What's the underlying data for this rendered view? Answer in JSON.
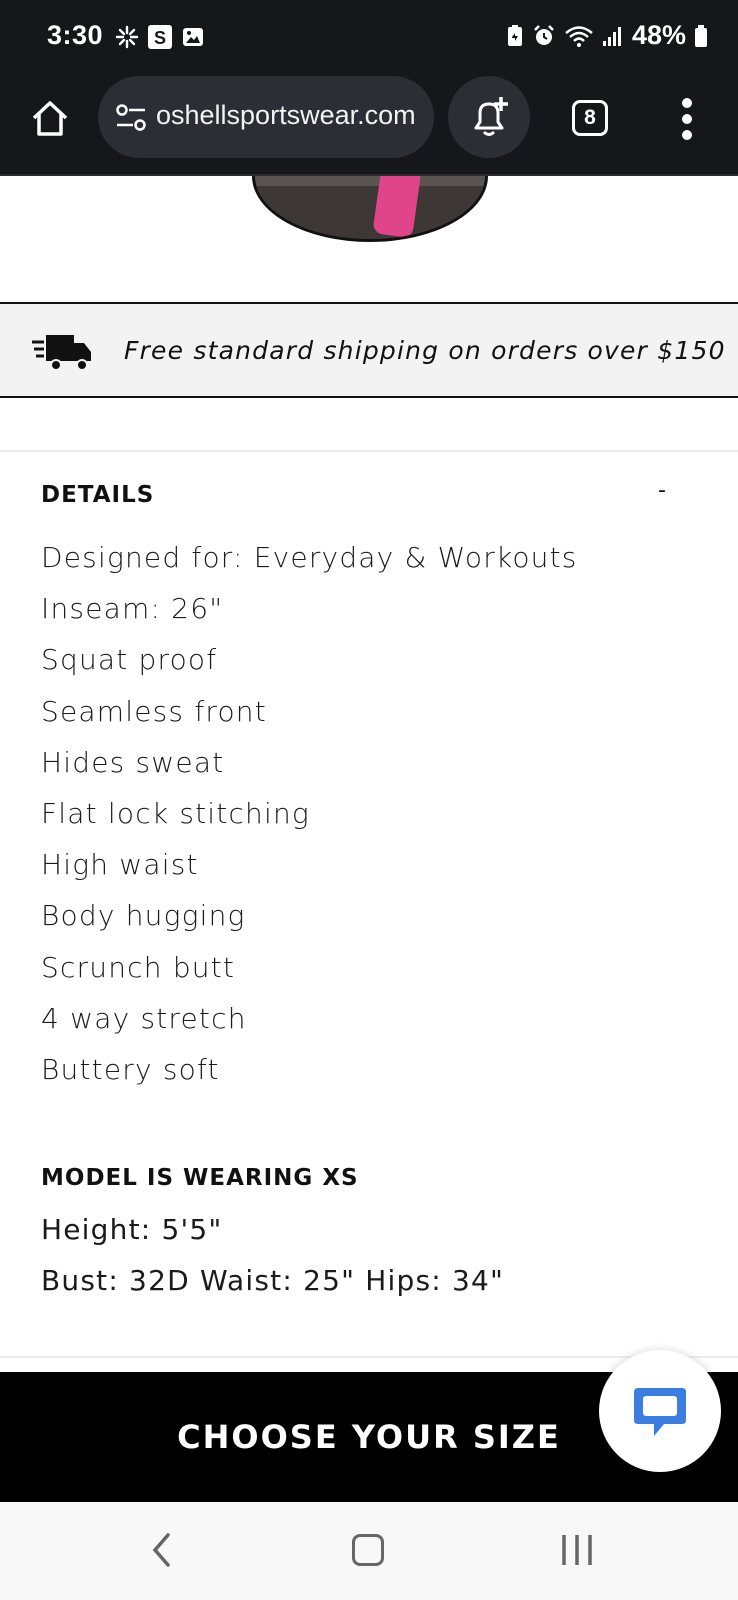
{
  "status_bar": {
    "time": "3:30",
    "battery": "48%",
    "left_icons": [
      "pinwheel-icon",
      "s-app-icon",
      "gallery-icon"
    ],
    "right_icons": [
      "battery-saver-icon",
      "alarm-icon",
      "wifi-icon",
      "signal-icon",
      "battery-icon"
    ]
  },
  "browser": {
    "url": "oshellsportswear.com",
    "tab_count": "8"
  },
  "shipping": {
    "text": "Free standard shipping on orders over $150"
  },
  "details": {
    "heading": "DETAILS",
    "collapse_label": "-",
    "items": [
      "Designed for: Everyday & Workouts",
      "Inseam: 26\"",
      "Squat proof",
      "Seamless front",
      "Hides sweat",
      "Flat lock stitching",
      "High waist",
      "Body hugging",
      "Scrunch butt",
      "4 way stretch",
      "Buttery soft"
    ]
  },
  "model": {
    "heading": "MODEL IS WEARING XS",
    "items": [
      "Height: 5'5\"",
      "Bust: 32D Waist: 25\" Hips: 34\""
    ]
  },
  "cta": {
    "label": "CHOOSE YOUR SIZE"
  },
  "colors": {
    "chrome_bg": "#16171b",
    "chat_blue": "#3b7de0",
    "cta_bg": "#000000"
  }
}
